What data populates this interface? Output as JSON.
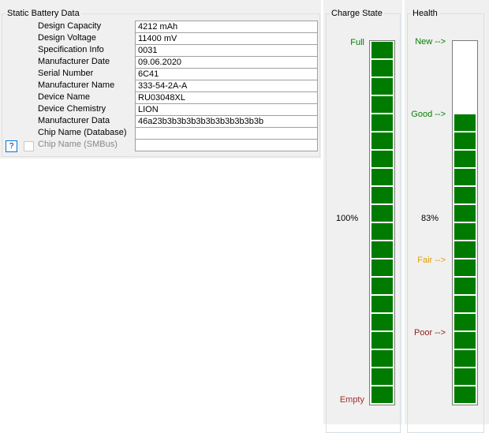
{
  "static_battery": {
    "title": "Static Battery Data",
    "rows": [
      {
        "label": "Design Capacity",
        "value": "4212 mAh"
      },
      {
        "label": "Design Voltage",
        "value": "11400 mV"
      },
      {
        "label": "Specification Info",
        "value": "0031"
      },
      {
        "label": "Manufacturer Date",
        "value": "09.06.2020"
      },
      {
        "label": "Serial Number",
        "value": "6C41"
      },
      {
        "label": "Manufacturer Name",
        "value": "333-54-2A-A"
      },
      {
        "label": "Device Name",
        "value": "RU03048XL"
      },
      {
        "label": "Device Chemistry",
        "value": "LION"
      },
      {
        "label": "Manufacturer Data",
        "value": "46a23b3b3b3b3b3b3b3b3b3b3b"
      },
      {
        "label": "Chip Name (Database)",
        "value": ""
      },
      {
        "label": "Chip Name (SMBus)",
        "value": ""
      }
    ],
    "help_label": "?"
  },
  "charge_state": {
    "title": "Charge State",
    "top_label": "Full",
    "bottom_label": "Empty",
    "percent_text": "100%",
    "level_fraction": 1.0,
    "segments": 20,
    "colors": {
      "fill": "#007b00",
      "top_label": "#008000",
      "bottom_label": "#a0302a"
    }
  },
  "health": {
    "title": "Health",
    "percent_text": "83%",
    "level_fraction": 0.83,
    "segments": 17,
    "markers": [
      {
        "label": "New -->",
        "color": "#008000",
        "level": 1.0
      },
      {
        "label": "Good -->",
        "color": "#008000",
        "level": 0.8
      },
      {
        "label": "Fair -->",
        "color": "#e0a000",
        "level": 0.4
      },
      {
        "label": "Poor -->",
        "color": "#8b2020",
        "level": 0.2
      }
    ],
    "colors": {
      "fill": "#007b00"
    }
  }
}
